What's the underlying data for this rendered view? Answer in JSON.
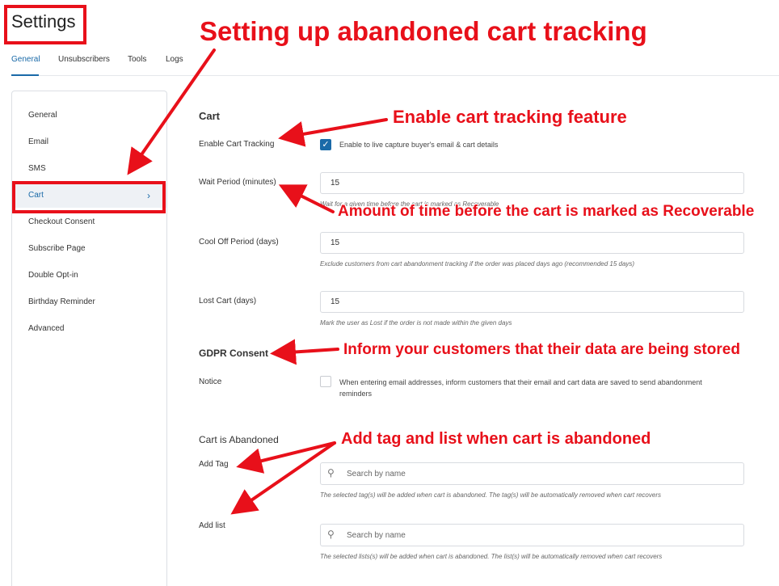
{
  "page": {
    "title": "Settings"
  },
  "tabs": [
    {
      "label": "General",
      "active": true
    },
    {
      "label": "Unsubscribers"
    },
    {
      "label": "Tools"
    },
    {
      "label": "Logs"
    }
  ],
  "sidebar": {
    "items": [
      {
        "label": "General"
      },
      {
        "label": "Email"
      },
      {
        "label": "SMS"
      },
      {
        "label": "Cart",
        "active": true
      },
      {
        "label": "Checkout Consent"
      },
      {
        "label": "Subscribe Page"
      },
      {
        "label": "Double Opt-in"
      },
      {
        "label": "Birthday Reminder"
      },
      {
        "label": "Advanced"
      }
    ]
  },
  "cart": {
    "title": "Cart",
    "enable_tracking": {
      "label": "Enable Cart Tracking",
      "checked": true,
      "text": "Enable to live capture buyer's email & cart details"
    },
    "wait_period": {
      "label": "Wait Period (minutes)",
      "value": "15",
      "help": "Wait for a given time before the cart is marked as Recoverable"
    },
    "cool_off": {
      "label": "Cool Off Period (days)",
      "value": "15",
      "help": "Exclude customers from cart abandonment tracking if the order was placed days ago (recommended 15 days)"
    },
    "lost_cart": {
      "label": "Lost Cart (days)",
      "value": "15",
      "help": "Mark the user as Lost if the order is not made within the given days"
    }
  },
  "gdpr": {
    "title": "GDPR Consent",
    "notice": {
      "label": "Notice",
      "checked": false,
      "text_line1": "When entering email addresses, inform customers that their email and cart data are saved to send abandonment",
      "text_line2": "reminders"
    }
  },
  "abandoned": {
    "title": "Cart is Abandoned",
    "add_tag": {
      "label": "Add Tag",
      "placeholder": "Search by name",
      "help": "The selected tag(s) will be added when cart is abandoned. The tag(s) will be automatically removed when cart recovers"
    },
    "add_list": {
      "label": "Add list",
      "placeholder": "Search by name",
      "help": "The selected lists(s) will be added when cart is abandoned. The list(s) will be automatically removed when cart recovers"
    }
  },
  "annotations": {
    "heading": "Setting up abandoned cart tracking",
    "enable": "Enable cart tracking feature",
    "wait": "Amount of time before the cart is marked as Recoverable",
    "gdpr": "Inform your customers that their data are being stored",
    "tag": "Add tag and list when cart is abandoned"
  },
  "colors": {
    "annotation": "#e8101a",
    "accent": "#1a6aa8"
  },
  "icons": [
    "chevron-right-icon",
    "check-icon",
    "search-icon",
    "arrow-icon"
  ]
}
